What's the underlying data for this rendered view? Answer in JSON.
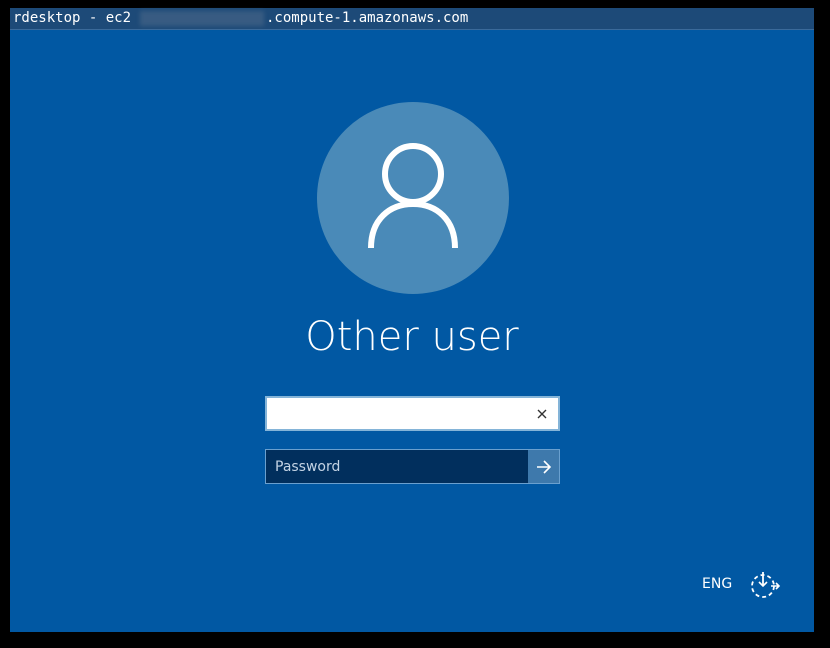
{
  "window": {
    "title_prefix": "rdesktop - ec2",
    "title_suffix": ".compute-1.amazonaws.com"
  },
  "login": {
    "username_label": "Other user",
    "username_value": "",
    "password_placeholder": "Password"
  },
  "bottom_bar": {
    "language": "ENG"
  },
  "icons": {
    "avatar": "user-silhouette-icon",
    "clear": "close-icon",
    "submit": "arrow-right-icon",
    "ease_of_access": "ease-of-access-icon"
  },
  "colors": {
    "background": "#0158a3",
    "avatar_circle": "#4a8ab8",
    "password_field": "#012f5d",
    "submit_button": "#3e79ac",
    "titlebar": "#1d4a78"
  }
}
